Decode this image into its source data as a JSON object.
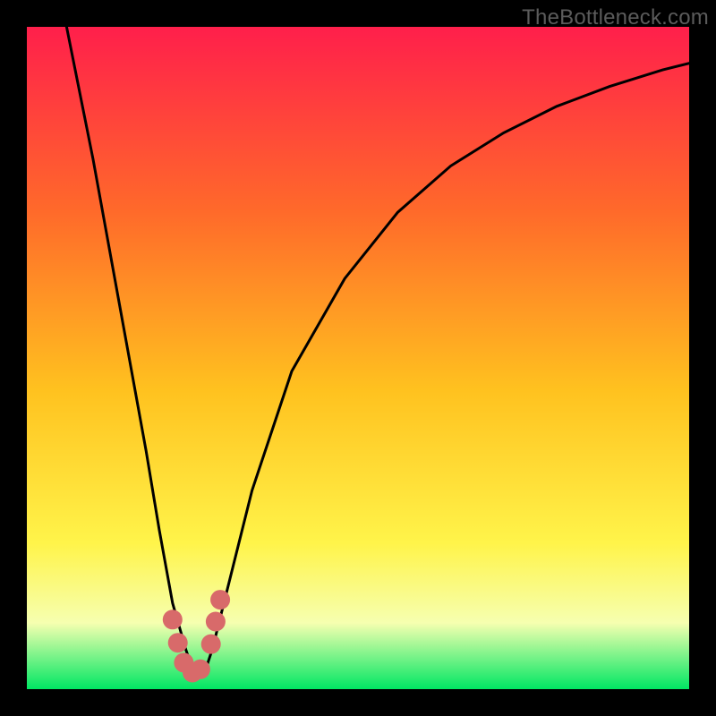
{
  "watermark": "TheBottleneck.com",
  "colors": {
    "frame": "#000000",
    "gradient_top": "#ff1f4b",
    "gradient_mid_upper": "#ff6a2a",
    "gradient_mid": "#ffc21f",
    "gradient_mid_lower": "#fff44a",
    "gradient_pale": "#f6ffb0",
    "gradient_bottom": "#00e763",
    "curve": "#000000",
    "marker": "#d86a6a"
  },
  "chart_data": {
    "type": "line",
    "title": "",
    "xlabel": "",
    "ylabel": "",
    "xlim": [
      0,
      100
    ],
    "ylim": [
      0,
      100
    ],
    "series": [
      {
        "name": "bottleneck-curve",
        "x": [
          6,
          10,
          14,
          18,
          20,
          22,
          24,
          25,
          26,
          27,
          28,
          30,
          34,
          40,
          48,
          56,
          64,
          72,
          80,
          88,
          96,
          100
        ],
        "y": [
          100,
          80,
          58,
          36,
          24,
          13,
          6,
          3,
          2,
          3,
          6,
          14,
          30,
          48,
          62,
          72,
          79,
          84,
          88,
          91,
          93.5,
          94.5
        ]
      }
    ],
    "markers": [
      {
        "x": 22.0,
        "y": 10.5
      },
      {
        "x": 22.8,
        "y": 7.0
      },
      {
        "x": 23.7,
        "y": 4.0
      },
      {
        "x": 25.0,
        "y": 2.5
      },
      {
        "x": 26.2,
        "y": 3.0
      },
      {
        "x": 27.8,
        "y": 6.8
      },
      {
        "x": 28.5,
        "y": 10.2
      },
      {
        "x": 29.2,
        "y": 13.5
      }
    ],
    "minimum": {
      "x": 25,
      "y": 2
    }
  }
}
